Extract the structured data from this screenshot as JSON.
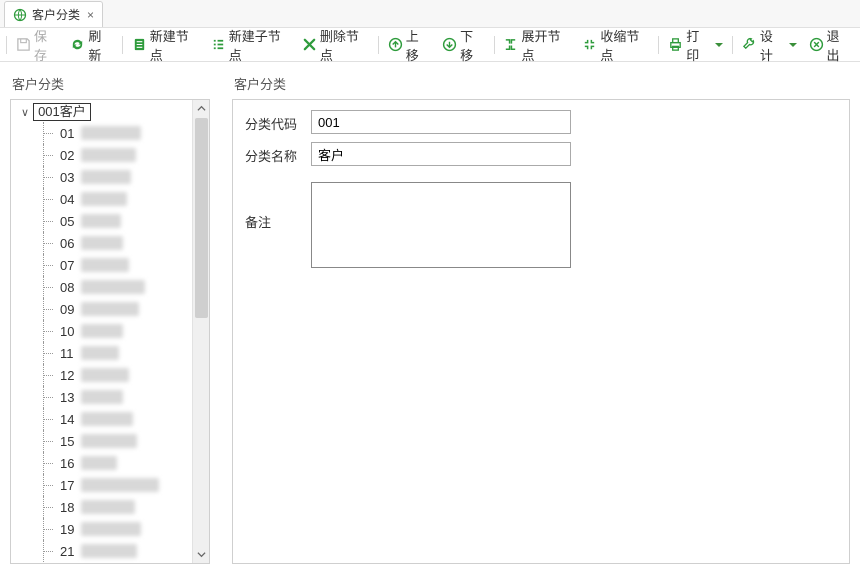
{
  "tab": {
    "title": "客户分类"
  },
  "toolbar": {
    "save": "保存",
    "refresh": "刷新",
    "new_node": "新建节点",
    "new_child": "新建子节点",
    "delete_node": "删除节点",
    "move_up": "上移",
    "move_down": "下移",
    "expand": "展开节点",
    "collapse": "收缩节点",
    "print": "打印",
    "design": "设计",
    "exit": "退出"
  },
  "panels": {
    "left_title": "客户分类",
    "right_title": "客户分类"
  },
  "tree": {
    "root": "001客户",
    "items": [
      {
        "num": "01",
        "blur_w": 60
      },
      {
        "num": "02",
        "blur_w": 55
      },
      {
        "num": "03",
        "blur_w": 50
      },
      {
        "num": "04",
        "blur_w": 46
      },
      {
        "num": "05",
        "blur_w": 40
      },
      {
        "num": "06",
        "blur_w": 42
      },
      {
        "num": "07",
        "blur_w": 48
      },
      {
        "num": "08",
        "blur_w": 64
      },
      {
        "num": "09",
        "blur_w": 58
      },
      {
        "num": "10",
        "blur_w": 42
      },
      {
        "num": "11",
        "blur_w": 38
      },
      {
        "num": "12",
        "blur_w": 48
      },
      {
        "num": "13",
        "blur_w": 42
      },
      {
        "num": "14",
        "blur_w": 52
      },
      {
        "num": "15",
        "blur_w": 56
      },
      {
        "num": "16",
        "blur_w": 36
      },
      {
        "num": "17",
        "blur_w": 78
      },
      {
        "num": "18",
        "blur_w": 54
      },
      {
        "num": "19",
        "blur_w": 60
      },
      {
        "num": "21",
        "blur_w": 56
      }
    ]
  },
  "form": {
    "code_label": "分类代码",
    "code_value": "001",
    "name_label": "分类名称",
    "name_value": "客户",
    "note_label": "备注",
    "note_value": ""
  }
}
